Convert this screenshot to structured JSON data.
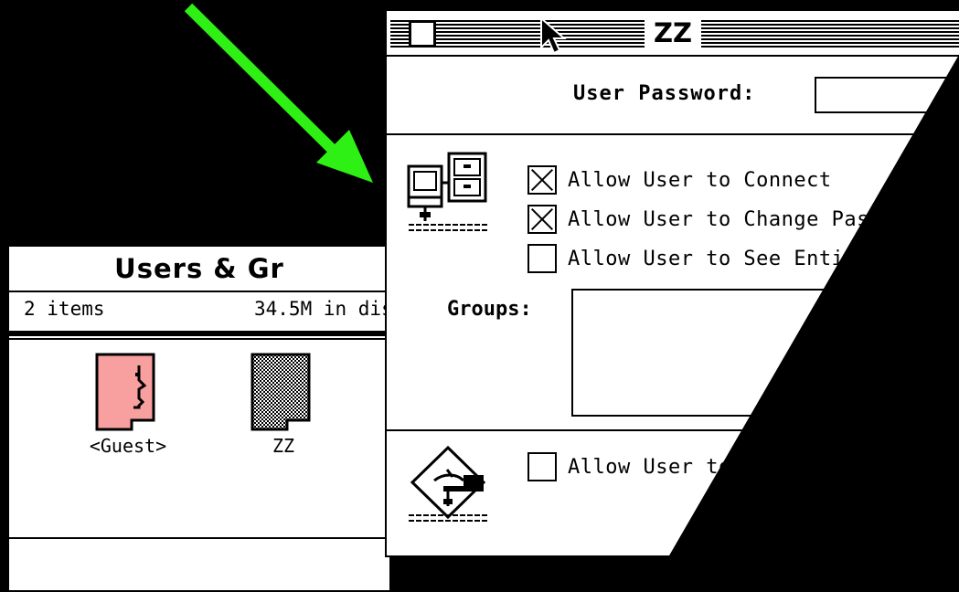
{
  "users_groups_window": {
    "title": "Users & Gr",
    "item_count": "2 items",
    "disk_info": "34.5M in dis",
    "users": [
      {
        "name": "<Guest>",
        "icon": "guest-face-icon",
        "color": "#F8A0A0"
      },
      {
        "name": "ZZ",
        "icon": "user-silhouette-icon",
        "color": "#ffffff"
      }
    ]
  },
  "zz_window": {
    "title": "ZZ",
    "password_label": "User Password:",
    "password_value": "",
    "file_sharing_icon": "file-sharing-computer-icon",
    "checkboxes": [
      {
        "label": "Allow User to Connect",
        "checked": true
      },
      {
        "label": "Allow User to Change Pass",
        "checked": true
      },
      {
        "label": "Allow User to See Entire",
        "checked": false
      }
    ],
    "groups_label": "Groups:",
    "program_linking_icon": "program-linking-hand-icon",
    "linking_checkbox": {
      "label": "Allow User to",
      "checked": false
    }
  },
  "colors": {
    "arrow": "#2EF014",
    "guest": "#F8A0A0",
    "background": "#000000"
  }
}
